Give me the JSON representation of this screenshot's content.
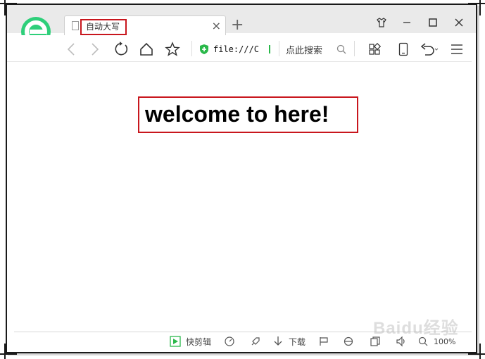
{
  "tab": {
    "title": "自动大写"
  },
  "address": {
    "value": "file:///C"
  },
  "search": {
    "label": "点此搜索"
  },
  "page": {
    "heading": "welcome to here!"
  },
  "statusbar": {
    "clip_label": "快剪辑",
    "download_label": "下载",
    "zoom": "100%"
  },
  "watermark": "Baidu经验",
  "colors": {
    "highlight_box": "#c8161d",
    "secure_green": "#2ab84a",
    "logo_green": "#2ecf7a"
  },
  "icons": [
    "browser-logo-icon",
    "back-icon",
    "forward-icon",
    "refresh-icon",
    "home-icon",
    "star-icon",
    "shield-icon",
    "search-icon",
    "apps-icon",
    "tablet-icon",
    "undo-icon",
    "menu-icon",
    "skin-icon",
    "minimize-icon",
    "maximize-icon",
    "close-icon"
  ]
}
